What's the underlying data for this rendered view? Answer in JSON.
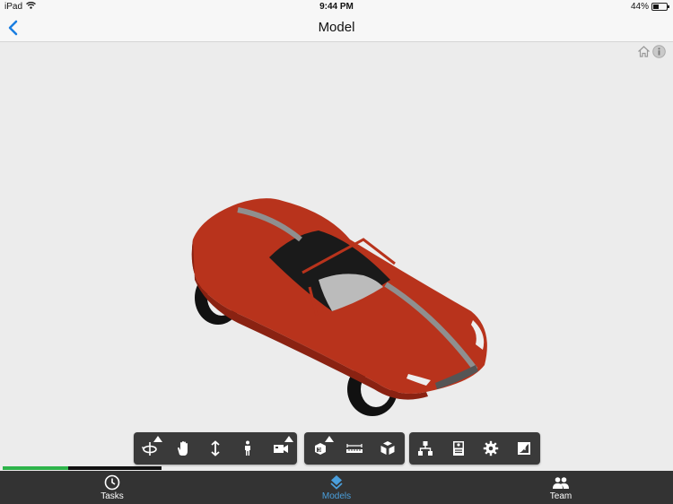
{
  "status_bar": {
    "device": "iPad",
    "time": "9:44 PM",
    "battery_percent_label": "44%",
    "battery_level": 0.44
  },
  "nav": {
    "title": "Model",
    "back_icon": "chevron-left-icon"
  },
  "viewer": {
    "corner_icons": [
      "home-icon",
      "info-icon"
    ],
    "model_description": "Red convertible sports car 3D model with grey racing stripe"
  },
  "toolbars": [
    {
      "name": "navigation",
      "tools": [
        {
          "icon": "orbit-icon",
          "has_menu": true
        },
        {
          "icon": "pan-hand-icon",
          "has_menu": false
        },
        {
          "icon": "zoom-vertical-icon",
          "has_menu": false
        },
        {
          "icon": "walk-person-icon",
          "has_menu": false
        },
        {
          "icon": "camera-icon",
          "has_menu": true
        }
      ]
    },
    {
      "name": "inspect",
      "tools": [
        {
          "icon": "section-box-icon",
          "has_menu": true
        },
        {
          "icon": "measure-icon",
          "has_menu": false
        },
        {
          "icon": "explode-cube-icon",
          "has_menu": false
        }
      ]
    },
    {
      "name": "settings",
      "tools": [
        {
          "icon": "model-tree-icon",
          "has_menu": false
        },
        {
          "icon": "properties-icon",
          "has_menu": false
        },
        {
          "icon": "settings-gear-icon",
          "has_menu": false
        },
        {
          "icon": "fullscreen-icon",
          "has_menu": false
        }
      ]
    }
  ],
  "load_progress": 0.41,
  "tabs": [
    {
      "label": "Tasks",
      "icon": "clock-icon",
      "active": false
    },
    {
      "label": "Models",
      "icon": "layers-icon",
      "active": true
    },
    {
      "label": "Team",
      "icon": "people-icon",
      "active": false
    }
  ],
  "colors": {
    "accent": "#4a9fdc",
    "progress": "#2db34a",
    "car_body": "#b8331c",
    "toolbar": "#3a3a3a",
    "tabbar": "#333333"
  }
}
